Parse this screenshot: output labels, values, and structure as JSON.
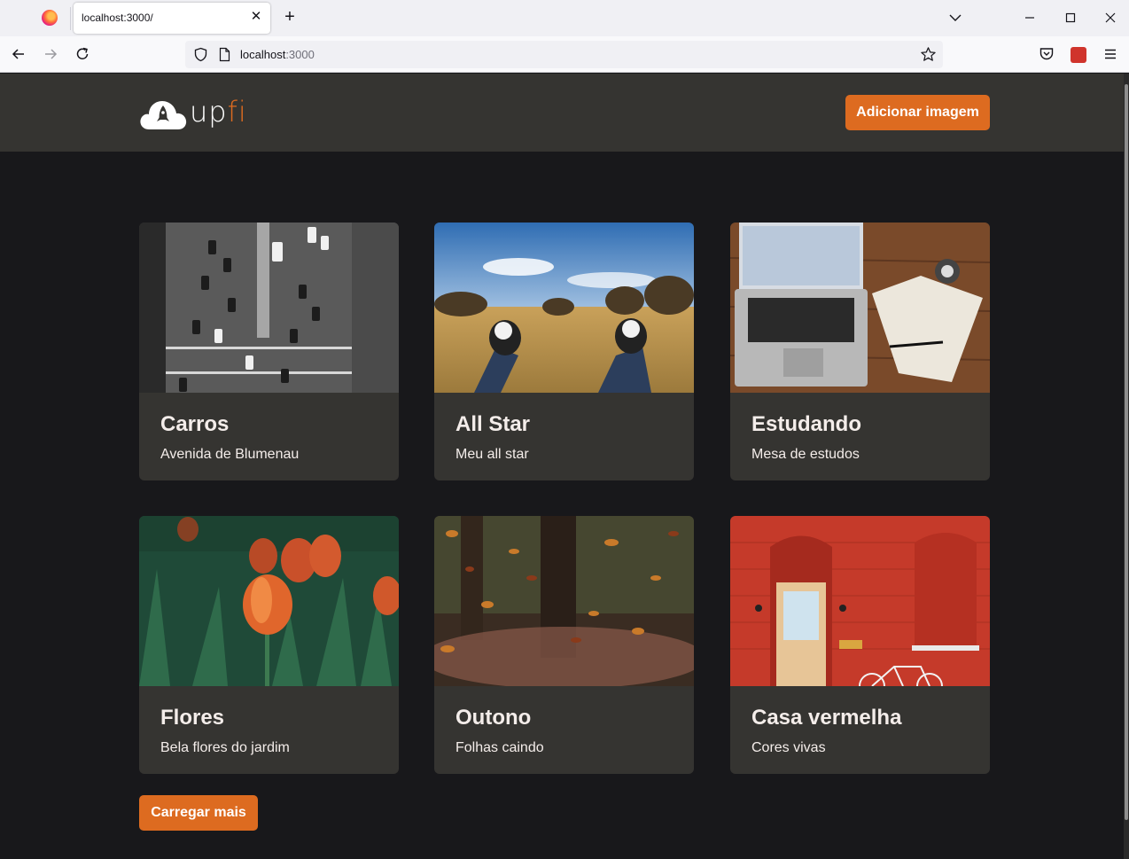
{
  "browser": {
    "tab_title": "localhost:3000/",
    "url_host": "localhost",
    "url_port": ":3000"
  },
  "header": {
    "logo_text_main": "up",
    "logo_text_accent": "fi",
    "add_button_label": "Adicionar imagem"
  },
  "cards": [
    {
      "title": "Carros",
      "description": "Avenida de Blumenau",
      "image": "cars-street-photo"
    },
    {
      "title": "All Star",
      "description": "Meu all star",
      "image": "sneakers-field-photo"
    },
    {
      "title": "Estudando",
      "description": "Mesa de estudos",
      "image": "laptop-desk-photo"
    },
    {
      "title": "Flores",
      "description": "Bela flores do jardim",
      "image": "tulips-photo"
    },
    {
      "title": "Outono",
      "description": "Folhas caindo",
      "image": "autumn-leaves-photo"
    },
    {
      "title": "Casa vermelha",
      "description": "Cores vivas",
      "image": "red-house-photo"
    }
  ],
  "load_more_label": "Carregar mais",
  "colors": {
    "accent": "#dd6b20",
    "header_bg": "#353431",
    "page_bg": "#18181b",
    "card_bg": "#353431",
    "text": "#f4edea"
  }
}
